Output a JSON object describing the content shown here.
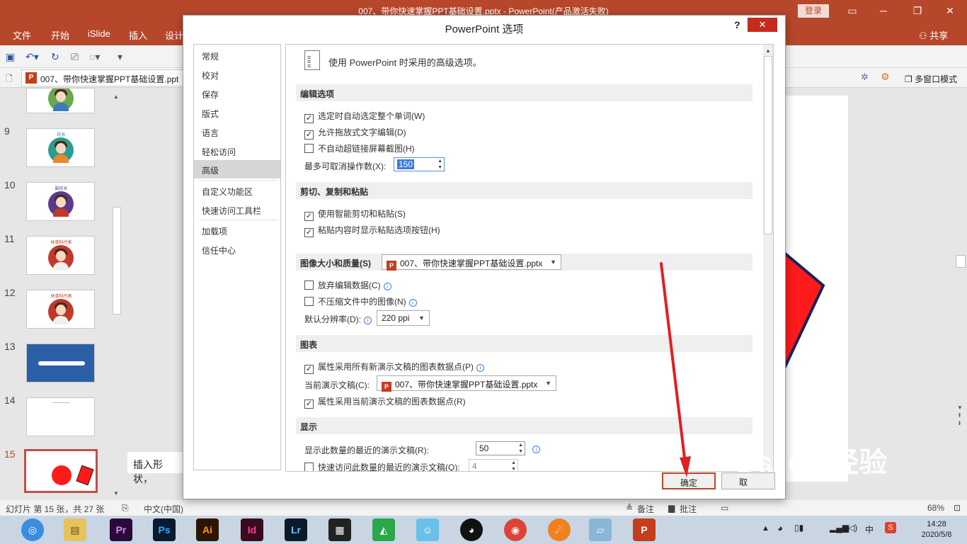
{
  "window": {
    "title": "007、带你快速掌握PPT基础设置.pptx  -  PowerPoint(产品激活失败)",
    "login_label": "登录",
    "min_icon": "minimize-icon",
    "max_icon": "restore-icon",
    "close_icon": "close-icon"
  },
  "ribbon": {
    "tabs": [
      "文件",
      "开始",
      "iSlide",
      "插入",
      "设计"
    ],
    "share_label": "共享"
  },
  "doc_tab": {
    "label": "007、带你快速掌握PPT基础设置.ppt",
    "icon_text": "P"
  },
  "multiwindow_label": "多窗口模式",
  "thumbnails": {
    "numbers": [
      "9",
      "10",
      "11",
      "12",
      "13",
      "14",
      "15"
    ],
    "captions": [
      "班长",
      "副班长",
      "体育科代表",
      "体育科代表"
    ]
  },
  "notes_text": "插入形状，",
  "statusbar": {
    "slide_info": "幻灯片 第 15 张，共 27 张",
    "language": "中文(中国)",
    "notes": "备注",
    "comments": "批注",
    "zoom": "68%"
  },
  "taskbar": {
    "apps": [
      "Pr",
      "Ps",
      "Ai",
      "Id",
      "Lr"
    ],
    "time": "14:28",
    "date": "2020/5/8",
    "ime": "中"
  },
  "dialog": {
    "title": "PowerPoint 选项",
    "help": "?",
    "nav": [
      "常规",
      "校对",
      "保存",
      "版式",
      "语言",
      "轻松访问",
      "高级",
      "自定义功能区",
      "快速访问工具栏",
      "加载项",
      "信任中心"
    ],
    "selected_nav": "高级",
    "header_text": "使用 PowerPoint 时采用的高级选项。",
    "sections": {
      "editing": "编辑选项",
      "clipboard": "剪切、复制和粘贴",
      "image": "图像大小和质量(S)",
      "chart": "图表",
      "display": "显示"
    },
    "options": {
      "select_word": "选定时自动选定整个单词(W)",
      "drag_drop": "允许拖放式文字编辑(D)",
      "no_hyperlink": "不自动超链接屏幕截图(H)",
      "max_undo_label": "最多可取消操作数(X):",
      "max_undo_value": "150",
      "smart_cut": "使用智能剪切和粘贴(S)",
      "paste_options": "粘贴内容时显示粘贴选项按钮(H)",
      "image_file": "007、带你快速掌握PPT基础设置.pptx",
      "discard_edit": "放弃编辑数据(C)",
      "no_compress": "不压缩文件中的图像(N)",
      "resolution_label": "默认分辨率(D):",
      "resolution_value": "220 ppi",
      "chart_all": "属性采用所有新演示文稿的图表数据点(P)",
      "current_doc_label": "当前演示文稿(C):",
      "current_doc_value": "007、带你快速掌握PPT基础设置.pptx",
      "chart_current": "属性采用当前演示文稿的图表数据点(R)",
      "recent_count_label": "显示此数量的最近的演示文稿(R):",
      "recent_count_value": "50",
      "quick_access_label": "快速访问此数量的最近的演示文稿(Q):",
      "quick_access_value": "4"
    },
    "ok_label": "确定",
    "cancel_label": "取"
  },
  "colors": {
    "accent": "#b7472a",
    "arrow": "#e02020"
  }
}
